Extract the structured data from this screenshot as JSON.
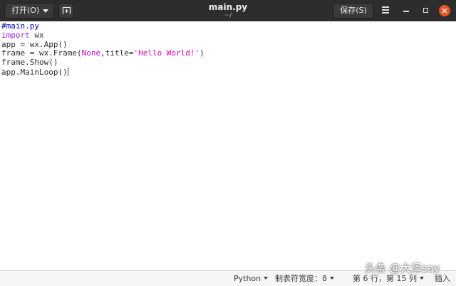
{
  "window": {
    "open_label": "打开(O)",
    "title": "main.py",
    "subtitle": "~/",
    "save_label": "保存(S)",
    "accent": "#e95420"
  },
  "code_lines": [
    {
      "parts": [
        {
          "t": "#main.py",
          "c": "cmt"
        }
      ]
    },
    {
      "parts": [
        {
          "t": "import",
          "c": "kw"
        },
        {
          "t": " wx",
          "c": ""
        }
      ]
    },
    {
      "parts": [
        {
          "t": "app = wx.App()",
          "c": ""
        }
      ]
    },
    {
      "parts": [
        {
          "t": "frame = wx.Frame(",
          "c": ""
        },
        {
          "t": "None",
          "c": "const"
        },
        {
          "t": ",title=",
          "c": ""
        },
        {
          "t": "'Hello World!'",
          "c": "str"
        },
        {
          "t": ")",
          "c": ""
        }
      ]
    },
    {
      "parts": [
        {
          "t": "frame.Show()",
          "c": ""
        }
      ]
    },
    {
      "parts": [
        {
          "t": "app.MainLoop()",
          "c": ""
        }
      ],
      "cursor": true
    }
  ],
  "status": {
    "language": "Python",
    "tab_width": "制表符宽度：8",
    "position": "第 6 行，第 15 列",
    "mode": "插入"
  },
  "watermark": "头条 @大泽say"
}
